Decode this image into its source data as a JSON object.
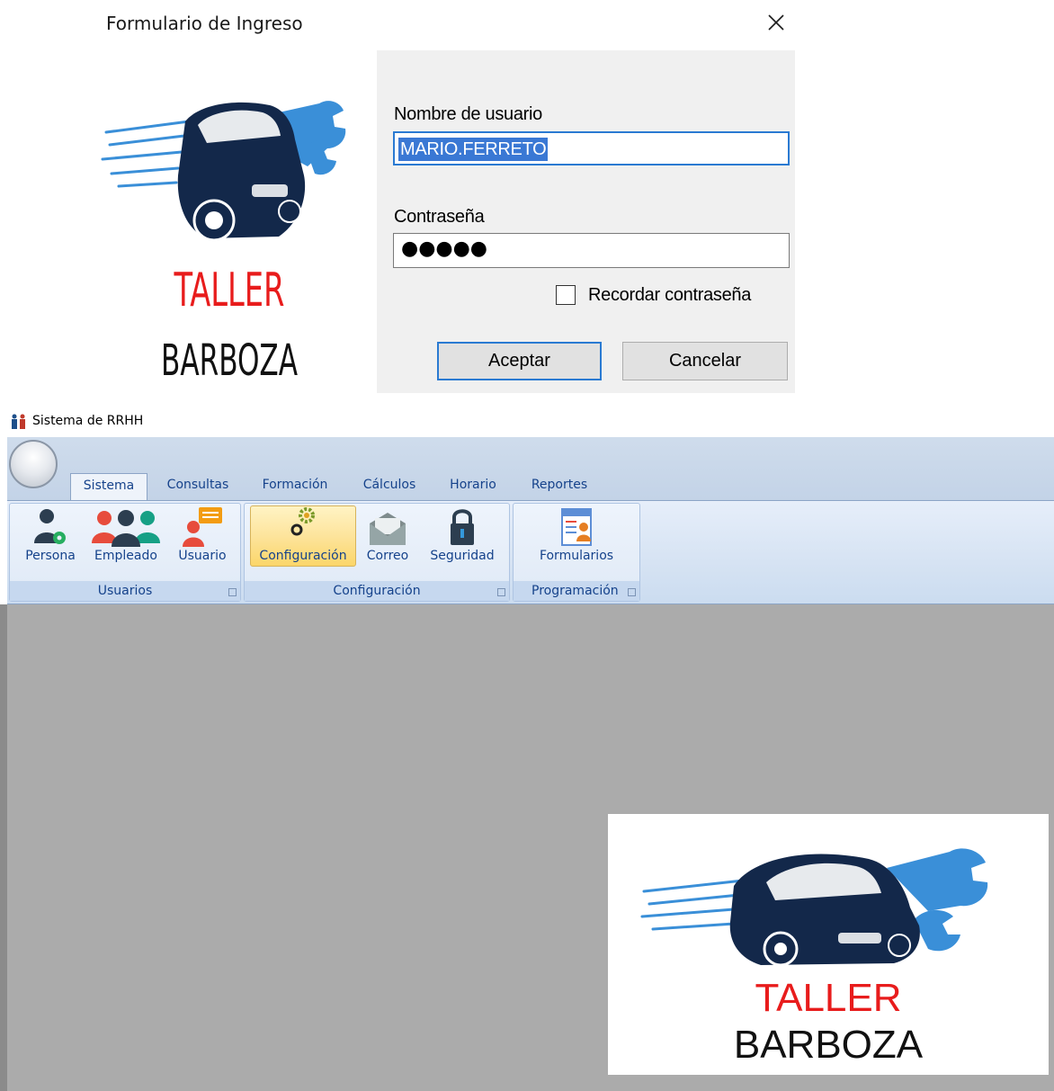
{
  "login": {
    "title": "Formulario de Ingreso",
    "close_glyph": "✕",
    "logo": {
      "line1": "TALLER",
      "line2": "BARBOZA",
      "line1_color": "#e81c1c",
      "line2_color": "#111111",
      "icon": "car-wrench-logo"
    },
    "username_label": "Nombre de usuario",
    "username_value": "MARIO.FERRETO",
    "password_label": "Contraseña",
    "password_masked": "●●●●●",
    "remember_label": "Recordar contraseña",
    "remember_checked": false,
    "ok_label": "Aceptar",
    "cancel_label": "Cancelar",
    "accent": "#2a7ad2"
  },
  "app": {
    "title": "Sistema de RRHH",
    "tabs": [
      "Sistema",
      "Consultas",
      "Formación",
      "Cálculos",
      "Horario",
      "Reportes"
    ],
    "active_tab": "Sistema",
    "groups": [
      {
        "label": "Usuarios",
        "buttons": [
          "Persona",
          "Empleado",
          "Usuario"
        ]
      },
      {
        "label": "Configuración",
        "buttons": [
          "Configuración",
          "Correo",
          "Seguridad"
        ]
      },
      {
        "label": "Programación",
        "buttons": [
          "Formularios"
        ]
      }
    ],
    "active_button": "Configuración",
    "workspace_logo": {
      "line1": "TALLER",
      "line2": "BARBOZA"
    }
  }
}
